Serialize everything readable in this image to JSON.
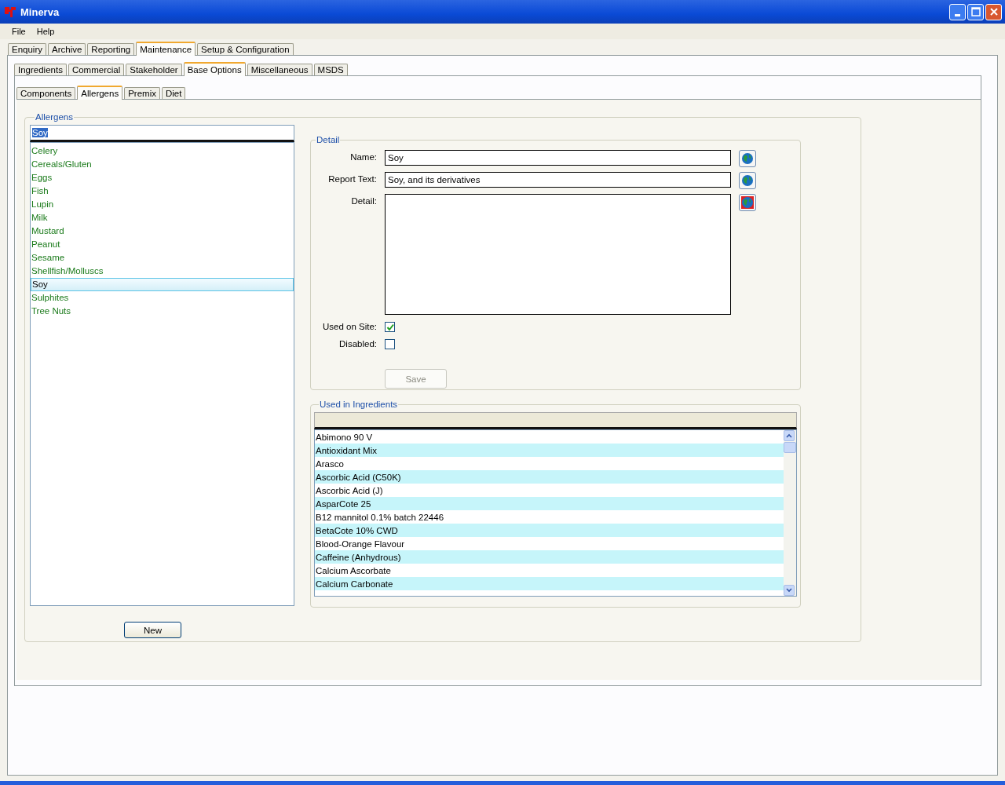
{
  "window": {
    "title": "Minerva"
  },
  "menu": [
    "File",
    "Help"
  ],
  "tabs": [
    {
      "label": "Enquiry",
      "selected": false
    },
    {
      "label": "Archive",
      "selected": false
    },
    {
      "label": "Reporting",
      "selected": false
    },
    {
      "label": "Maintenance",
      "selected": true
    },
    {
      "label": "Setup & Configuration",
      "selected": false
    }
  ],
  "subtabs": [
    {
      "label": "Ingredients",
      "selected": false
    },
    {
      "label": "Commercial",
      "selected": false
    },
    {
      "label": "Stakeholder",
      "selected": false
    },
    {
      "label": "Base Options",
      "selected": true
    },
    {
      "label": "Miscellaneous",
      "selected": false
    },
    {
      "label": "MSDS",
      "selected": false
    }
  ],
  "inner_tabs": [
    {
      "label": "Components",
      "selected": false
    },
    {
      "label": "Allergens",
      "selected": true
    },
    {
      "label": "Premix",
      "selected": false
    },
    {
      "label": "Diet",
      "selected": false
    }
  ],
  "allergens": {
    "title": "Allergens",
    "search": "Soy",
    "items": [
      {
        "label": "Celery",
        "selected": false
      },
      {
        "label": "Cereals/Gluten",
        "selected": false
      },
      {
        "label": "Eggs",
        "selected": false
      },
      {
        "label": "Fish",
        "selected": false
      },
      {
        "label": "Lupin",
        "selected": false
      },
      {
        "label": "Milk",
        "selected": false
      },
      {
        "label": "Mustard",
        "selected": false
      },
      {
        "label": "Peanut",
        "selected": false
      },
      {
        "label": "Sesame",
        "selected": false
      },
      {
        "label": "Shellfish/Molluscs",
        "selected": false
      },
      {
        "label": "Soy",
        "selected": true
      },
      {
        "label": "Sulphites",
        "selected": false
      },
      {
        "label": "Tree Nuts",
        "selected": false
      }
    ],
    "new_button": "New"
  },
  "detail": {
    "title": "Detail",
    "name_label": "Name:",
    "name": "Soy",
    "report_label": "Report Text:",
    "report_text": "Soy, and its derivatives",
    "detail_label": "Detail:",
    "used_on_site": {
      "label": "Used on Site:",
      "checked": true
    },
    "disabled": {
      "label": "Disabled:",
      "checked": false
    },
    "save_button": "Save"
  },
  "used_in_ingredients": {
    "title": "Used in Ingredients",
    "rows": [
      "Abimono 90 V",
      "Antioxidant Mix",
      "Arasco",
      "Ascorbic Acid (C50K)",
      "Ascorbic Acid (J)",
      "AsparCote 25",
      "B12 mannitol 0.1% batch 22446",
      "BetaCote 10% CWD",
      "Blood-Orange Flavour",
      "Caffeine (Anhydrous)",
      "Calcium Ascorbate",
      "Calcium Carbonate"
    ]
  }
}
